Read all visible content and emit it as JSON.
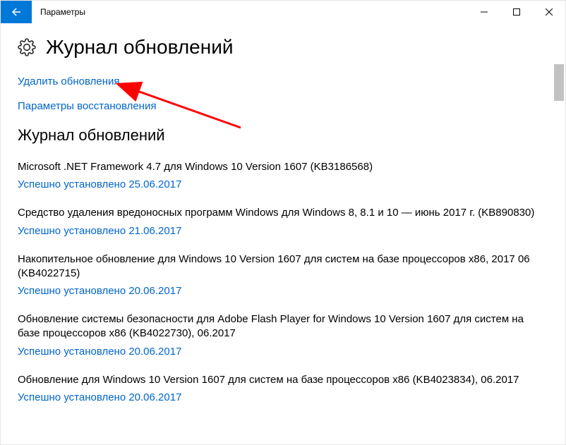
{
  "titlebar": {
    "title": "Параметры"
  },
  "page": {
    "title": "Журнал обновлений",
    "link_uninstall": "Удалить обновления",
    "link_recovery": "Параметры восстановления",
    "section_heading": "Журнал обновлений"
  },
  "updates": [
    {
      "title": "Microsoft .NET Framework 4.7 для Windows 10 Version 1607 (KB3186568)",
      "status": "Успешно установлено 25.06.2017"
    },
    {
      "title": "Средство удаления вредоносных программ Windows для Windows 8, 8.1 и 10 — июнь 2017 г. (KB890830)",
      "status": "Успешно установлено 21.06.2017"
    },
    {
      "title": "Накопительное обновление для Windows 10 Version 1607 для систем на базе процессоров x86, 2017 06 (KB4022715)",
      "status": "Успешно установлено 20.06.2017"
    },
    {
      "title": "Обновление системы безопасности для Adobe Flash Player for Windows 10 Version 1607 для систем на базе процессоров x86 (KB4022730), 06.2017",
      "status": "Успешно установлено 20.06.2017"
    },
    {
      "title": "Обновление для Windows 10 Version 1607 для систем на базе процессоров x86 (KB4023834), 06.2017",
      "status": "Успешно установлено 20.06.2017"
    }
  ]
}
